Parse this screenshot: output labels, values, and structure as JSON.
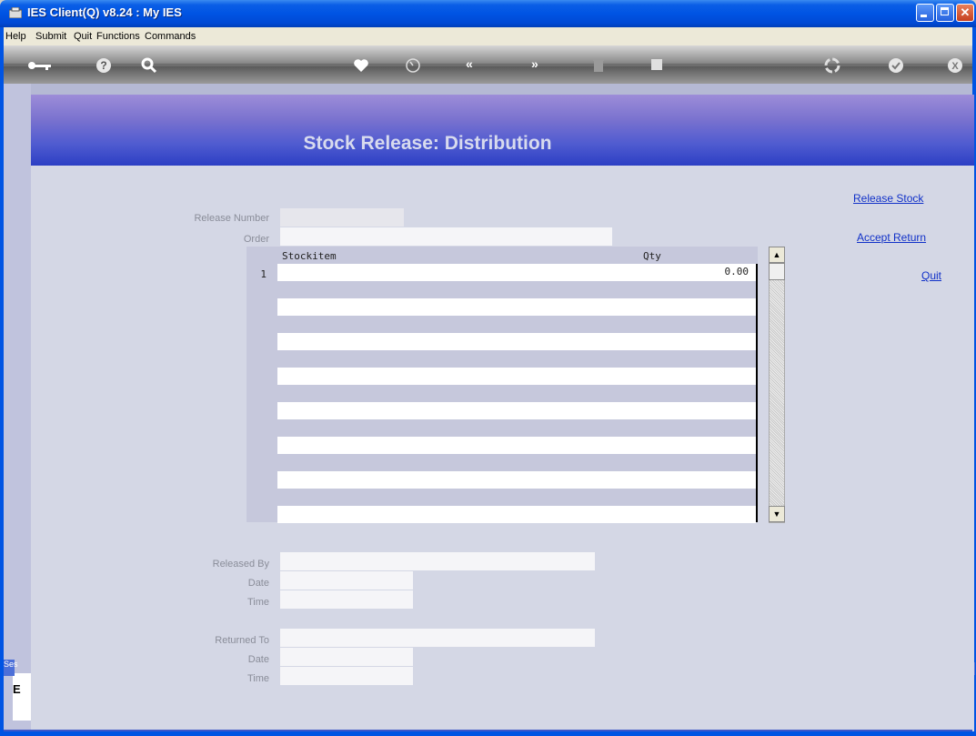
{
  "window": {
    "title": "IES Client(Q) v8.24 : My IES"
  },
  "menu": {
    "items": [
      "Help",
      "Submit",
      "Quit",
      "Functions",
      "Commands"
    ]
  },
  "toolbar": {
    "icons": [
      "key-icon",
      "help-icon",
      "search-icon",
      "heart-icon",
      "clock-icon",
      "rewind-icon",
      "forward-icon",
      "trash-icon",
      "stop-icon",
      "recycle-icon",
      "check-icon",
      "close-icon"
    ]
  },
  "page": {
    "title": "Stock Release: Distribution"
  },
  "actions": {
    "release_stock": "Release Stock",
    "accept_return": "Accept Return",
    "quit": "Quit"
  },
  "form": {
    "release_number_label": "Release Number",
    "release_number_value": "",
    "order_label": "Order",
    "order_value": "",
    "released_by_label": "Released By",
    "released_date_label": "Date",
    "released_time_label": "Time",
    "returned_to_label": "Returned To",
    "returned_date_label": "Date",
    "returned_time_label": "Time"
  },
  "grid": {
    "columns": [
      "Stockitem",
      "Qty"
    ],
    "rows": [
      {
        "num": "1",
        "stockitem": "",
        "qty": "0.00"
      }
    ]
  },
  "sidebar": {
    "session_tab": "Ses",
    "session_letter": "E"
  },
  "colors": {
    "title_bar": "#0054e3",
    "banner_top": "#9d8dd8",
    "banner_bottom": "#2c3fc4",
    "link": "#1030c8"
  }
}
